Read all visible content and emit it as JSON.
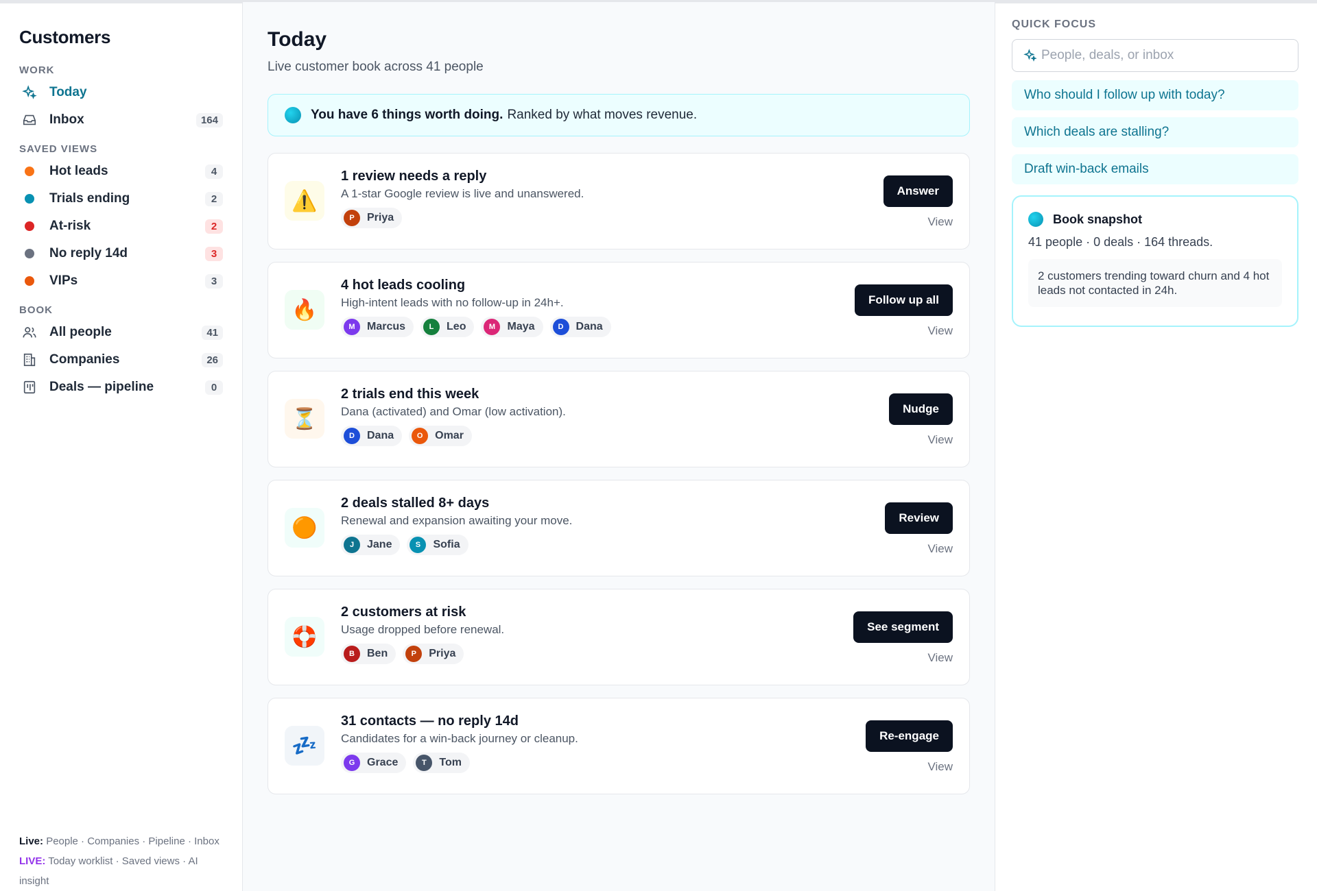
{
  "sidebar": {
    "title": "Customers",
    "sections": {
      "work": "WORK",
      "saved_views": "SAVED VIEWS",
      "book": "BOOK"
    },
    "work_items": [
      {
        "label": "Today",
        "icon": "sparkle-icon",
        "count": ""
      },
      {
        "label": "Inbox",
        "icon": "inbox-icon",
        "count": "164"
      }
    ],
    "saved_views": [
      {
        "label": "Hot leads",
        "color": "#f97316",
        "count": "4",
        "count_style": "plain"
      },
      {
        "label": "Trials ending",
        "color": "#0891b2",
        "count": "2",
        "count_style": "plain"
      },
      {
        "label": "At-risk",
        "color": "#dc2626",
        "count": "2",
        "count_style": "red"
      },
      {
        "label": "No reply 14d",
        "color": "#6b7280",
        "count": "3",
        "count_style": "red"
      },
      {
        "label": "VIPs",
        "color": "#ea580c",
        "count": "3",
        "count_style": "plain"
      }
    ],
    "book_items": [
      {
        "label": "All people",
        "icon": "people-icon",
        "count": "41"
      },
      {
        "label": "Companies",
        "icon": "building-icon",
        "count": "26"
      },
      {
        "label": "Deals — pipeline",
        "icon": "pipeline-icon",
        "count": "0"
      }
    ],
    "footer": {
      "live_label": "Live:",
      "live_text": "People · Companies · Pipeline · Inbox",
      "live2_label": "LIVE:",
      "live2_text": "Today worklist · Saved views · AI insight"
    }
  },
  "main": {
    "title": "Today",
    "subtitle": "Live customer book across 41 people",
    "banner": {
      "strong": "You have 6 things worth doing.",
      "rest": "Ranked by what moves revenue."
    },
    "cards": [
      {
        "icon": "⚠️",
        "icon_name": "warning-icon",
        "icon_bg": "#fefce8",
        "title": "1 review needs a reply",
        "desc": "A 1-star Google review is live and unanswered.",
        "button": "Answer",
        "view": "View",
        "people": [
          {
            "initial": "P",
            "name": "Priya",
            "color": "#c2410c"
          }
        ]
      },
      {
        "icon": "🔥",
        "icon_name": "fire-icon",
        "icon_bg": "#f0fdf4",
        "title": "4 hot leads cooling",
        "desc": "High-intent leads with no follow-up in 24h+.",
        "button": "Follow up all",
        "view": "View",
        "people": [
          {
            "initial": "M",
            "name": "Marcus",
            "color": "#7c3aed"
          },
          {
            "initial": "L",
            "name": "Leo",
            "color": "#15803d"
          },
          {
            "initial": "M",
            "name": "Maya",
            "color": "#db2777"
          },
          {
            "initial": "D",
            "name": "Dana",
            "color": "#1d4ed8"
          }
        ]
      },
      {
        "icon": "⏳",
        "icon_name": "hourglass-icon",
        "icon_bg": "#fff7ed",
        "title": "2 trials end this week",
        "desc": "Dana (activated) and Omar (low activation).",
        "button": "Nudge",
        "view": "View",
        "people": [
          {
            "initial": "D",
            "name": "Dana",
            "color": "#1d4ed8"
          },
          {
            "initial": "O",
            "name": "Omar",
            "color": "#ea580c"
          }
        ]
      },
      {
        "icon": "🟠",
        "icon_name": "orange-circle-icon",
        "icon_bg": "#f0fdfa",
        "title": "2 deals stalled 8+ days",
        "desc": "Renewal and expansion awaiting your move.",
        "button": "Review",
        "view": "View",
        "people": [
          {
            "initial": "J",
            "name": "Jane",
            "color": "#0e7490"
          },
          {
            "initial": "S",
            "name": "Sofia",
            "color": "#0891b2"
          }
        ]
      },
      {
        "icon": "🛟",
        "icon_name": "lifebuoy-icon",
        "icon_bg": "#f0fdfa",
        "title": "2 customers at risk",
        "desc": "Usage dropped before renewal.",
        "button": "See segment",
        "view": "View",
        "people": [
          {
            "initial": "B",
            "name": "Ben",
            "color": "#b91c1c"
          },
          {
            "initial": "P",
            "name": "Priya",
            "color": "#c2410c"
          }
        ]
      },
      {
        "icon": "💤",
        "icon_name": "sleep-icon",
        "icon_bg": "#f1f5f9",
        "title": "31 contacts — no reply 14d",
        "desc": "Candidates for a win-back journey or cleanup.",
        "button": "Re-engage",
        "view": "View",
        "people": [
          {
            "initial": "G",
            "name": "Grace",
            "color": "#7c3aed"
          },
          {
            "initial": "T",
            "name": "Tom",
            "color": "#475569"
          }
        ]
      }
    ]
  },
  "right": {
    "label": "QUICK FOCUS",
    "search_placeholder": "People, deals, or inbox",
    "suggestions": [
      "Who should I follow up with today?",
      "Which deals are stalling?",
      "Draft win-back emails"
    ],
    "snapshot": {
      "title": "Book snapshot",
      "stats": "41 people · 0 deals · 164 threads.",
      "note": "2 customers trending toward churn and 4 hot leads not contacted in 24h."
    }
  },
  "colors": {
    "accent": "#0e7490",
    "button": "#0b1220"
  }
}
